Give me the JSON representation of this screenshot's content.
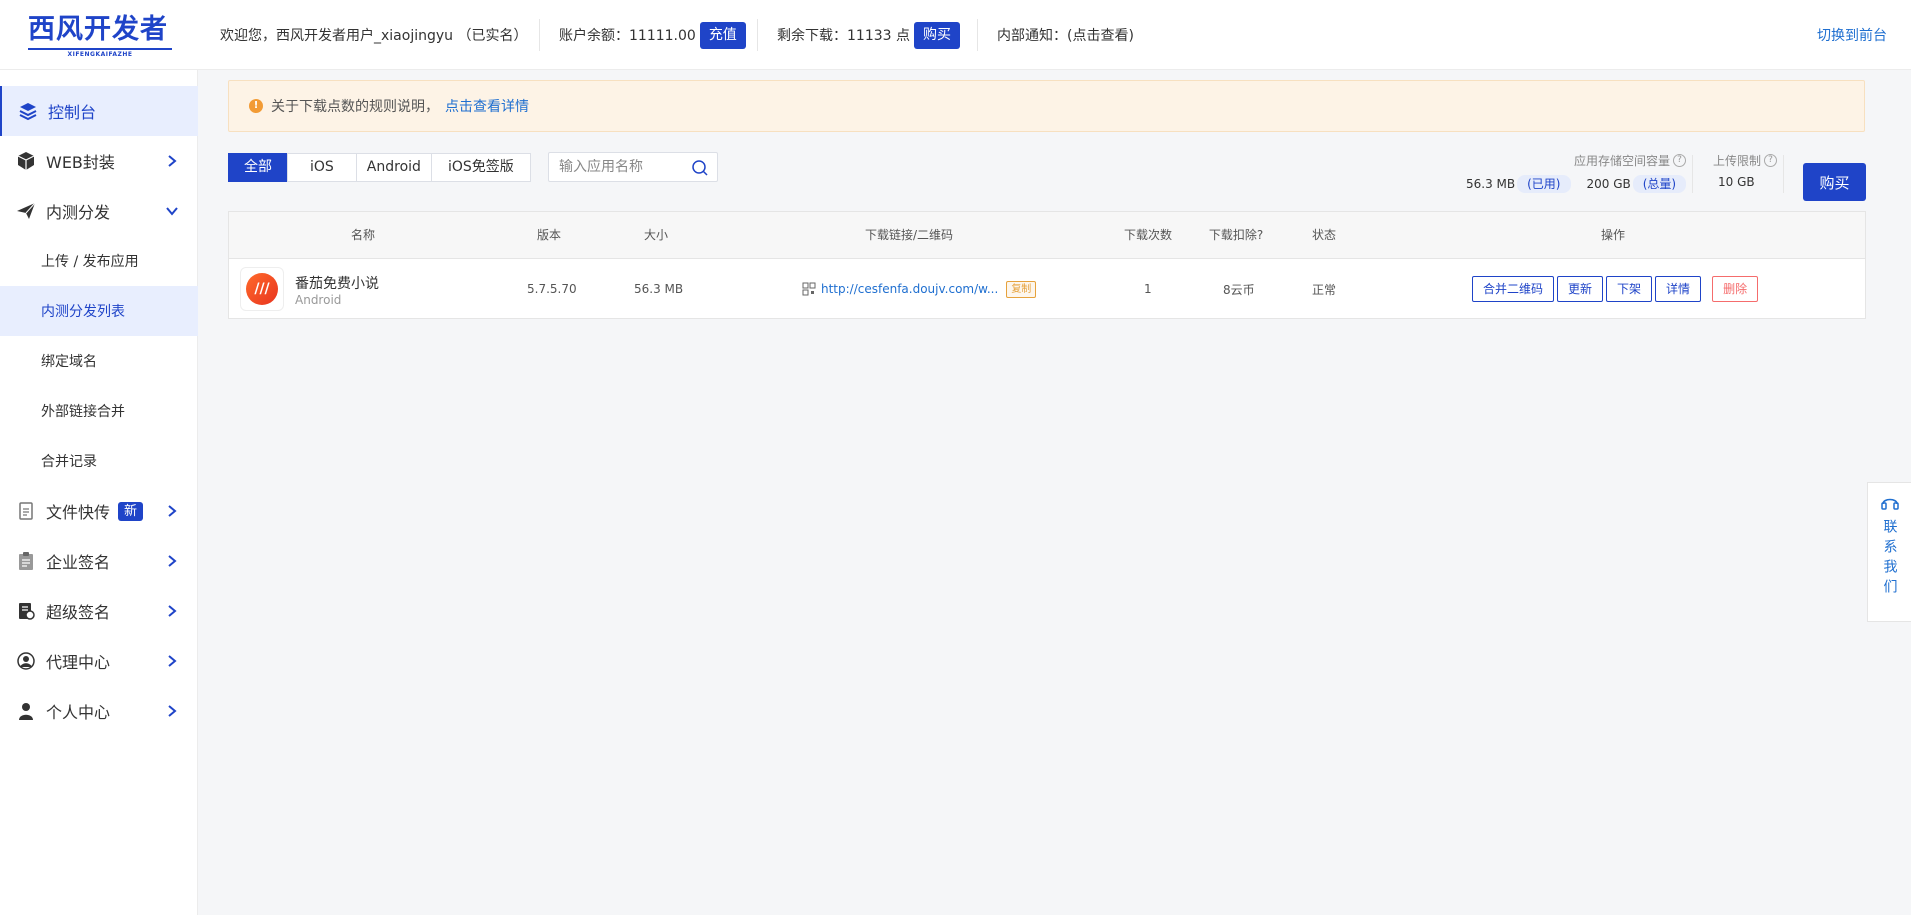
{
  "header": {
    "logo_text": "西风开发者",
    "logo_sub": "XIFENGKAIFAZHE",
    "welcome": "欢迎您，西风开发者用户_xiaojingyu （已实名）",
    "balance_label": "账户余额：11111.00",
    "recharge_label": "充值",
    "downloads_label": "剩余下载：11133 点",
    "buy_label": "购买",
    "notice_label": "内部通知：(点击查看)",
    "switch_label": "切换到前台"
  },
  "sidebar": {
    "items": [
      {
        "label": "控制台",
        "icon": "layers-icon"
      },
      {
        "label": "WEB封装",
        "icon": "box-icon"
      },
      {
        "label": "内测分发",
        "icon": "paper-plane-icon"
      },
      {
        "label": "文件快传",
        "icon": "file-transfer-icon",
        "badge": "新"
      },
      {
        "label": "企业签名",
        "icon": "clipboard-icon"
      },
      {
        "label": "超级签名",
        "icon": "document-seal-icon"
      },
      {
        "label": "代理中心",
        "icon": "agent-icon"
      },
      {
        "label": "个人中心",
        "icon": "user-icon"
      }
    ],
    "sub_items": [
      {
        "label": "上传 / 发布应用"
      },
      {
        "label": "内测分发列表"
      },
      {
        "label": "绑定域名"
      },
      {
        "label": "外部链接合并"
      },
      {
        "label": "合并记录"
      }
    ]
  },
  "notice": {
    "text": "关于下载点数的规则说明，",
    "link": "点击查看详情"
  },
  "filters": {
    "tabs": [
      "全部",
      "iOS",
      "Android",
      "iOS免签版"
    ],
    "active": "全部",
    "search_placeholder": "输入应用名称"
  },
  "storage": {
    "capacity_label": "应用存储空间容量",
    "used_value": "56.3 MB",
    "used_tag": "(已用)",
    "total_value": "200 GB",
    "total_tag": "(总量)",
    "upload_limit_label": "上传限制",
    "upload_limit_value": "10 GB",
    "buy_label": "购买"
  },
  "table": {
    "columns": [
      "名称",
      "版本",
      "大小",
      "下载链接/二维码",
      "下载次数",
      "下载扣除?",
      "状态",
      "操作"
    ],
    "rows": [
      {
        "name": "番茄免费小说",
        "platform": "Android",
        "version": "5.7.5.70",
        "size": "56.3 MB",
        "link": "http://cesfenfa.doujv.com/w...",
        "copy_label": "复制",
        "downloads": "1",
        "deduction": "8云币",
        "status": "正常",
        "actions": [
          "合并二维码",
          "更新",
          "下架",
          "详情",
          "删除"
        ]
      }
    ]
  },
  "contact": {
    "label": "联系我们"
  },
  "colors": {
    "primary": "#1f44c8",
    "link": "#1f6fd0",
    "danger": "#f56c6c",
    "warning": "#e6a23c"
  }
}
